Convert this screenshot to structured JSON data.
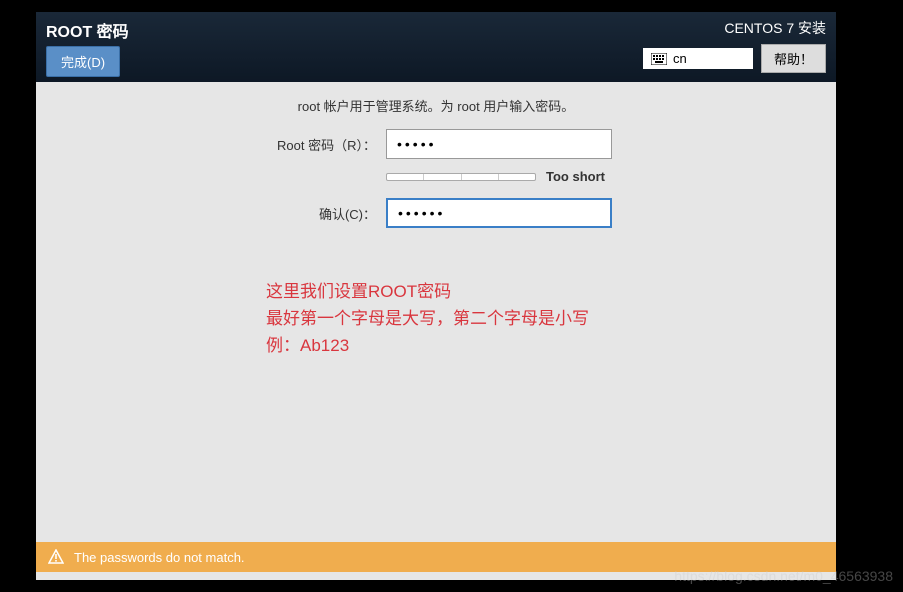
{
  "header": {
    "title": "ROOT 密码",
    "done_label": "完成(D)",
    "brand": "CENTOS 7 安装",
    "lang_code": "cn",
    "help_label": "帮助！"
  },
  "form": {
    "instruction": "root 帐户用于管理系统。为 root 用户输入密码。",
    "password_label": "Root 密码（R）：",
    "password_value": "•••••",
    "strength_text": "Too short",
    "confirm_label": "确认(C)：",
    "confirm_value": "••••••"
  },
  "annotation": {
    "line1": "这里我们设置ROOT密码",
    "line2": "最好第一个字母是大写，第二个字母是小写",
    "line3": "例：Ab123"
  },
  "warning": {
    "message": "The passwords do not match."
  },
  "watermark": "https://blog.csdn.net/m0_46563938"
}
